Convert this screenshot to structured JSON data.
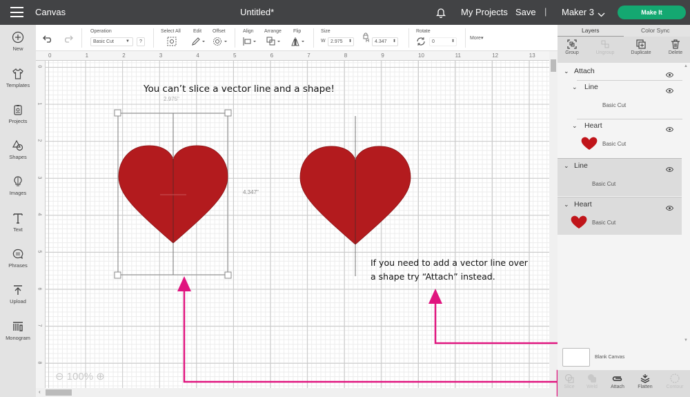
{
  "topbar": {
    "app_name": "Canvas",
    "document_title": "Untitled*",
    "my_projects": "My Projects",
    "save": "Save",
    "separator": "|",
    "machine": "Maker 3",
    "make_it": "Make It",
    "make_it_color": "#14a871"
  },
  "left_nav": [
    {
      "label": "New",
      "icon": "plus-circle-icon"
    },
    {
      "label": "Templates",
      "icon": "tshirt-icon"
    },
    {
      "label": "Projects",
      "icon": "projects-icon"
    },
    {
      "label": "Shapes",
      "icon": "shapes-icon"
    },
    {
      "label": "Images",
      "icon": "lightbulb-icon"
    },
    {
      "label": "Text",
      "icon": "text-icon"
    },
    {
      "label": "Phrases",
      "icon": "speech-bubble-icon"
    },
    {
      "label": "Upload",
      "icon": "upload-icon"
    },
    {
      "label": "Monogram",
      "icon": "monogram-icon"
    }
  ],
  "toolbar": {
    "operation_label": "Operation",
    "operation_value": "Basic Cut",
    "help": "?",
    "select_all": "Select All",
    "edit": "Edit",
    "offset": "Offset",
    "align": "Align",
    "arrange": "Arrange",
    "flip": "Flip",
    "size_label": "Size",
    "width_prefix": "W",
    "width_value": "2.975",
    "height_prefix": "H",
    "height_value": "4.347",
    "rotate_label": "Rotate",
    "rotate_value": "0",
    "more": "More▾"
  },
  "rulers": {
    "horizontal": [
      "0",
      "1",
      "2",
      "3",
      "4",
      "5",
      "6",
      "7",
      "8",
      "9",
      "10",
      "11",
      "12",
      "13"
    ],
    "vertical": [
      "0",
      "1",
      "2",
      "3",
      "4",
      "5",
      "6",
      "7",
      "8"
    ]
  },
  "canvas": {
    "heading_annotation": "You can’t slice a vector line and a shape!",
    "width_dimension": "2.975\"",
    "height_dimension": "4.347\"",
    "tip_line1": "If you need to add a vector line over",
    "tip_line2": "a shape try “Attach” instead.",
    "zoom_level": "100%",
    "heart_color": "#b31b1e",
    "arrow_color": "#e0157f"
  },
  "panel": {
    "tabs": [
      "Layers",
      "Color Sync"
    ],
    "actions": [
      {
        "label": "Group",
        "enabled": true
      },
      {
        "label": "Ungroup",
        "enabled": false
      },
      {
        "label": "Duplicate",
        "enabled": true
      },
      {
        "label": "Delete",
        "enabled": true
      }
    ],
    "layers": {
      "attach_group": "Attach",
      "line_1": "Line",
      "line_1_op": "Basic Cut",
      "heart_1": "Heart",
      "heart_1_op": "Basic Cut",
      "line_2": "Line",
      "line_2_op": "Basic Cut",
      "heart_2": "Heart",
      "heart_2_op": "Basic Cut"
    },
    "blank_canvas": "Blank Canvas",
    "bottom_tools": [
      {
        "label": "Slice",
        "enabled": false
      },
      {
        "label": "Weld",
        "enabled": false
      },
      {
        "label": "Attach",
        "enabled": true
      },
      {
        "label": "Flatten",
        "enabled": true
      },
      {
        "label": "Contour",
        "enabled": false
      }
    ]
  }
}
